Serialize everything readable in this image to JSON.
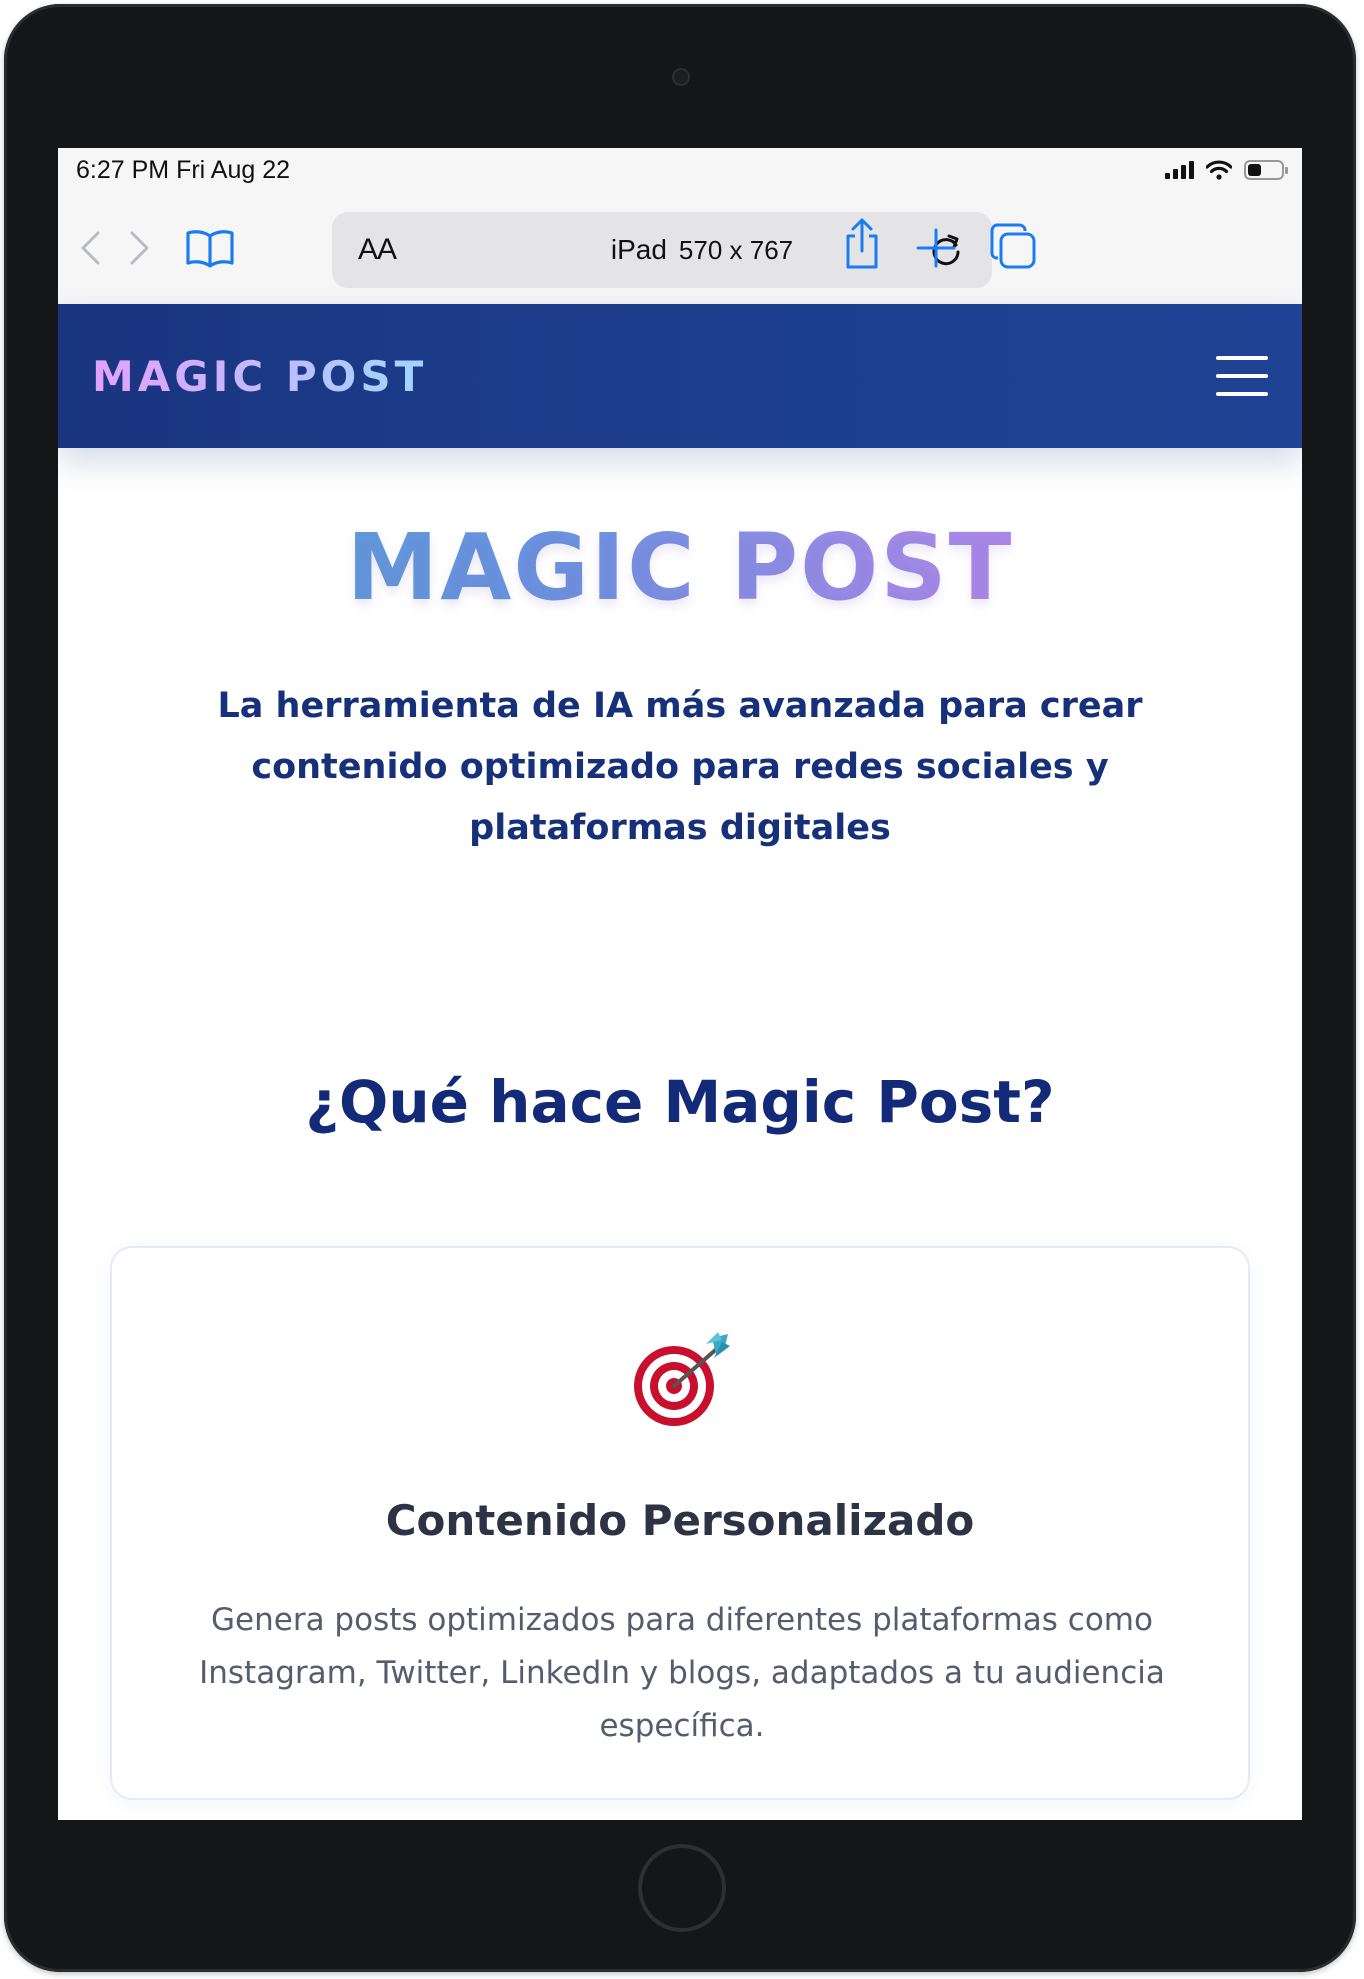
{
  "status_bar": {
    "time": "6:27 PM",
    "date": "Fri Aug 22"
  },
  "browser": {
    "text_size_label": "AA",
    "device_label": "iPad",
    "viewport_size": "570 x 767"
  },
  "site": {
    "brand": "MAGIC POST",
    "hero_title": "MAGIC POST",
    "hero_subtitle": "La herramienta de IA más avanzada para crear contenido optimizado para redes sociales y plataformas digitales",
    "section_title": "¿Qué hace Magic Post?",
    "features": [
      {
        "icon": "target-dart-icon",
        "title": "Contenido Personalizado",
        "description": "Genera posts optimizados para diferentes plataformas como Instagram, Twitter, LinkedIn y blogs, adaptados a tu audiencia específica."
      }
    ]
  },
  "colors": {
    "header_bg": "#1d3f8f",
    "heading_navy": "#132a78",
    "ios_blue": "#1a7cf0"
  }
}
